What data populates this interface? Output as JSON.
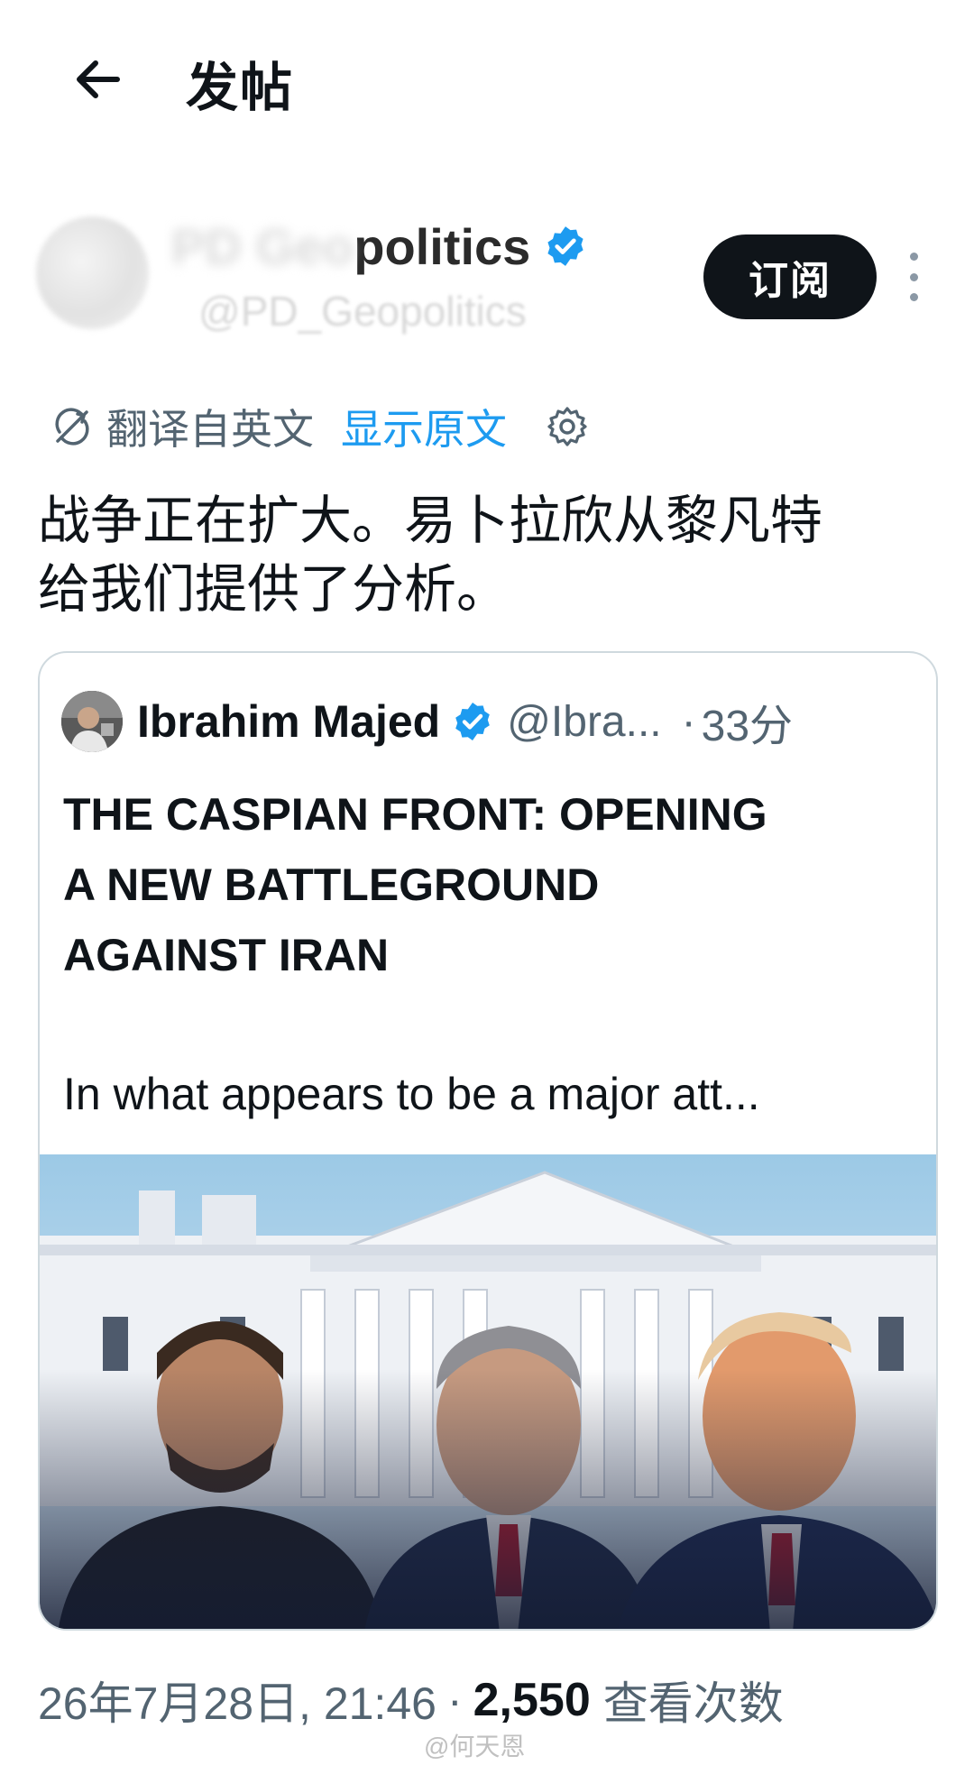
{
  "header": {
    "title": "发帖"
  },
  "author": {
    "name_visible": "politics",
    "handle_visible": "politics",
    "subscribe_label": "订阅"
  },
  "translation": {
    "label": "翻译自英文",
    "show_original": "显示原文"
  },
  "tweet": {
    "line1": "战争正在扩大。易卜拉欣从黎凡特",
    "line2": "给我们提供了分析。"
  },
  "quote": {
    "name": "Ibrahim Majed",
    "handle": "@Ibra...",
    "time": "33分",
    "headline_line1": "THE CASPIAN FRONT: OPENING",
    "headline_line2": "A NEW BATTLEGROUND",
    "headline_line3": "AGAINST IRAN",
    "snippet": "In what appears to be a major att..."
  },
  "meta": {
    "date": "26年7月28日, 21:46",
    "views": "2,550",
    "views_label": "查看次数"
  },
  "watermark": "@何天恩",
  "colors": {
    "accent_blue": "#1d9bf0",
    "text_primary": "#0f1419",
    "text_secondary": "#536471",
    "border": "#cfd9de"
  },
  "icons": [
    "back-arrow-icon",
    "verified-badge-icon",
    "more-vertical-icon",
    "translate-icon",
    "settings-gear-icon"
  ]
}
